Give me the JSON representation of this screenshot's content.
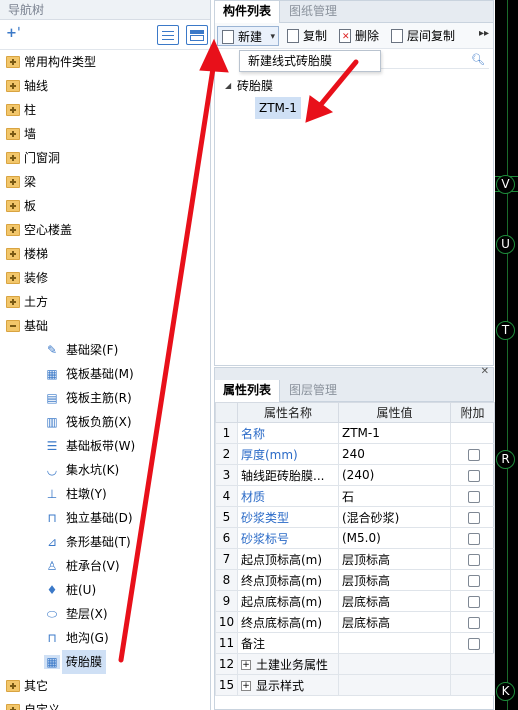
{
  "nav": {
    "title": "导航树",
    "items": [
      {
        "label": "常用构件类型"
      },
      {
        "label": "轴线"
      },
      {
        "label": "柱"
      },
      {
        "label": "墙"
      },
      {
        "label": "门窗洞"
      },
      {
        "label": "梁"
      },
      {
        "label": "板"
      },
      {
        "label": "空心楼盖"
      },
      {
        "label": "楼梯"
      },
      {
        "label": "装修"
      },
      {
        "label": "土方"
      },
      {
        "label": "基础"
      }
    ],
    "foundation_children": [
      {
        "label": "基础梁(F)",
        "icon": "✎"
      },
      {
        "label": "筏板基础(M)",
        "icon": "▦"
      },
      {
        "label": "筏板主筋(R)",
        "icon": "▤"
      },
      {
        "label": "筏板负筋(X)",
        "icon": "▥"
      },
      {
        "label": "基础板带(W)",
        "icon": "☰"
      },
      {
        "label": "集水坑(K)",
        "icon": "◡"
      },
      {
        "label": "柱墩(Y)",
        "icon": "⊥"
      },
      {
        "label": "独立基础(D)",
        "icon": "⊓"
      },
      {
        "label": "条形基础(T)",
        "icon": "⊿"
      },
      {
        "label": "桩承台(V)",
        "icon": "♙"
      },
      {
        "label": "桩(U)",
        "icon": "♦"
      },
      {
        "label": "垫层(X)",
        "icon": "⬭"
      },
      {
        "label": "地沟(G)",
        "icon": "⊓"
      },
      {
        "label": "砖胎膜",
        "icon": "▦"
      }
    ],
    "after_items": [
      {
        "label": "其它"
      },
      {
        "label": "自定义"
      }
    ]
  },
  "components": {
    "tabs": [
      "构件列表",
      "图纸管理"
    ],
    "toolbar": {
      "new": "新建",
      "copy": "复制",
      "delete": "删除",
      "floor_copy": "层间复制"
    },
    "dropdown_item": "新建线式砖胎膜",
    "tree_root": "砖胎膜",
    "tree_child": "ZTM-1"
  },
  "properties": {
    "tabs": [
      "属性列表",
      "图层管理"
    ],
    "headers": [
      "属性名称",
      "属性值",
      "附加"
    ],
    "rows": [
      {
        "num": "1",
        "name": "名称",
        "value": "ZTM-1",
        "blue": true,
        "check": false
      },
      {
        "num": "2",
        "name": "厚度(mm)",
        "value": "240",
        "blue": true,
        "check": true
      },
      {
        "num": "3",
        "name": "轴线距砖胎膜...",
        "value": "(240)",
        "blue": false,
        "check": true
      },
      {
        "num": "4",
        "name": "材质",
        "value": "石",
        "blue": true,
        "check": true
      },
      {
        "num": "5",
        "name": "砂浆类型",
        "value": "(混合砂浆)",
        "blue": true,
        "check": true
      },
      {
        "num": "6",
        "name": "砂浆标号",
        "value": "(M5.0)",
        "blue": true,
        "check": true
      },
      {
        "num": "7",
        "name": "起点顶标高(m)",
        "value": "层顶标高",
        "blue": false,
        "check": true
      },
      {
        "num": "8",
        "name": "终点顶标高(m)",
        "value": "层顶标高",
        "blue": false,
        "check": true
      },
      {
        "num": "9",
        "name": "起点底标高(m)",
        "value": "层底标高",
        "blue": false,
        "check": true
      },
      {
        "num": "10",
        "name": "终点底标高(m)",
        "value": "层底标高",
        "blue": false,
        "check": true
      },
      {
        "num": "11",
        "name": "备注",
        "value": "",
        "blue": false,
        "check": true
      }
    ],
    "groups": [
      {
        "num": "12",
        "name": "土建业务属性"
      },
      {
        "num": "15",
        "name": "显示样式"
      }
    ]
  },
  "canvas": {
    "axes": [
      "V",
      "U",
      "T",
      "R",
      "K"
    ]
  },
  "colors": {
    "accent": "#3b79c8",
    "arrow": "#e8101a",
    "selection": "#cfe0f5"
  }
}
